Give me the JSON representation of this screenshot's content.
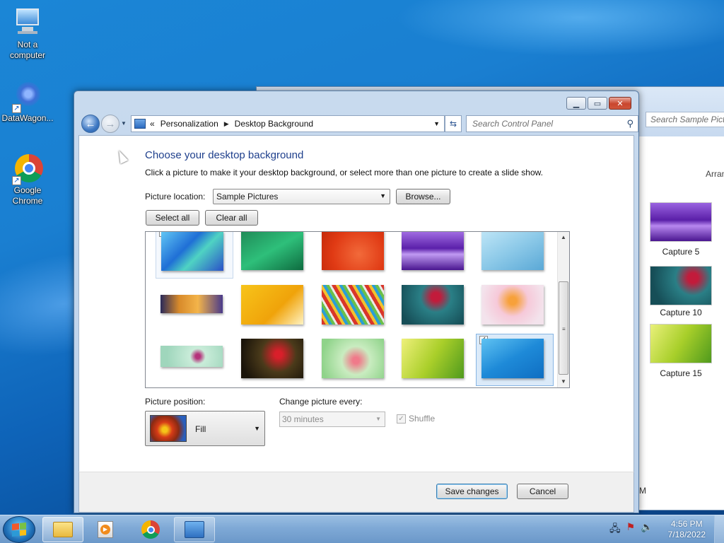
{
  "desktop": {
    "icons": [
      {
        "label": "Not a\ncomputer",
        "line1": "Not a",
        "line2": "computer",
        "icon": "computer-icon"
      },
      {
        "label": "DataWagon...",
        "icon": "datawagon-icon"
      },
      {
        "label": "Google Chrome",
        "line1": "Google",
        "line2": "Chrome",
        "icon": "chrome-icon"
      }
    ]
  },
  "background_window": {
    "search_placeholder": "Search Sample Pictu",
    "arrange_text": "Arran",
    "items": [
      "Capture 5",
      "Capture 10",
      "Capture 15"
    ],
    "bottom_text": "M"
  },
  "window": {
    "breadcrumb": [
      "Personalization",
      "Desktop Background"
    ],
    "breadcrumb_prefix": "«",
    "search_placeholder": "Search Control Panel",
    "title": "Choose your desktop background",
    "description": "Click a picture to make it your desktop background, or select more than one picture to create a slide show.",
    "picture_location_label": "Picture location:",
    "picture_location_value": "Sample Pictures",
    "browse_label": "Browse...",
    "select_all_label": "Select all",
    "clear_all_label": "Clear all",
    "picture_position_label": "Picture position:",
    "picture_position_value": "Fill",
    "change_picture_label": "Change picture every:",
    "change_picture_value": "30 minutes",
    "shuffle_label": "Shuffle",
    "shuffle_checked": true,
    "save_label": "Save changes",
    "cancel_label": "Cancel"
  },
  "taskbar": {
    "clock_time": "4:56 PM",
    "clock_date": "7/18/2022"
  }
}
